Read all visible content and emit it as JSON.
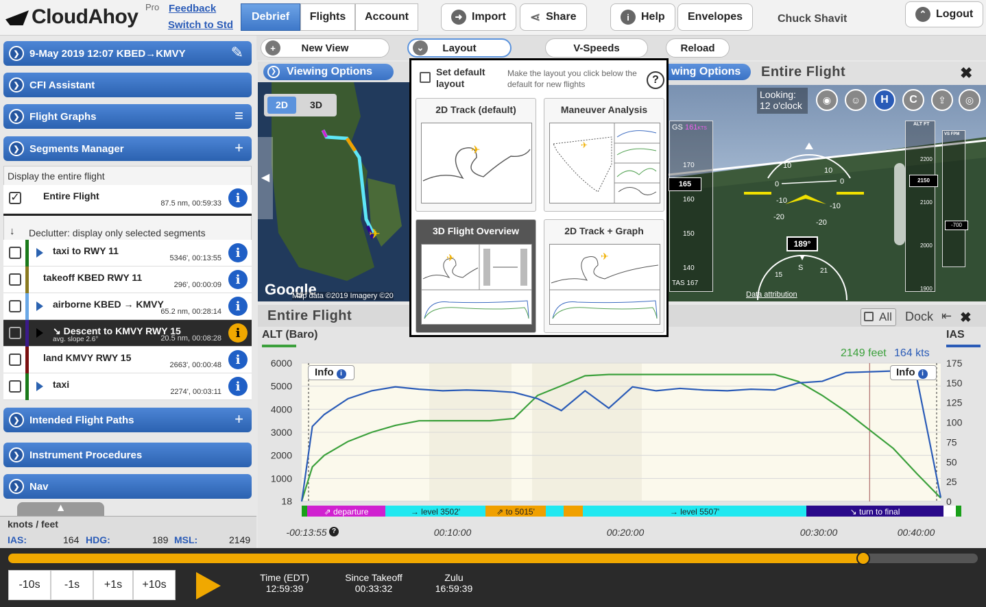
{
  "brand": {
    "logo_text": "CloudAhoy",
    "pro": "Pro",
    "feedback": "Feedback",
    "switch": "Switch to Std"
  },
  "tabs": [
    "Debrief",
    "Flights",
    "Account"
  ],
  "top_buttons": {
    "import": "Import",
    "share": "Share",
    "help": "Help",
    "envelopes": "Envelopes",
    "user": "Chuck Shavit",
    "logout": "Logout"
  },
  "sidebar": {
    "flight_header": "9-May 2019 12:07   KBED→KMVY",
    "cfi": "CFI Assistant",
    "graphs": "Flight Graphs",
    "segments": "Segments Manager",
    "display_entire": "Display the entire flight",
    "entire": {
      "name": "Entire Flight",
      "stat": "87.5 nm, 00:59:33"
    },
    "declutter": "Declutter: display only selected segments",
    "segs": [
      {
        "name": "taxi to RWY 11",
        "stat": "5346', 00:13:55",
        "color": "#1a7a1a"
      },
      {
        "name": "takeoff KBED RWY 11",
        "stat": "296', 00:00:09",
        "color": "#8a7a20"
      },
      {
        "name": "airborne KBED → KMVY",
        "stat": "65.2 nm, 00:28:14",
        "color": "#6aa8e6"
      },
      {
        "name": "↘ Descent to KMVY RWY 15",
        "sub": "avg. slope 2.6°",
        "stat": "20.5 nm, 00:08:28",
        "color": "#3a1a8a"
      },
      {
        "name": "land KMVY RWY 15",
        "stat": "2663', 00:00:48",
        "color": "#7a1010"
      },
      {
        "name": "taxi",
        "stat": "2274', 00:03:11",
        "color": "#1a7a1a"
      }
    ],
    "intended": "Intended Flight Paths",
    "instrument": "Instrument Procedures",
    "nav": "Nav",
    "units": "knots / feet",
    "ias_label": "IAS:",
    "ias": "164",
    "hdg_label": "HDG:",
    "hdg": "189",
    "msl_label": "MSL:",
    "msl": "2149"
  },
  "toolbar": {
    "new_view": "New View",
    "layout": "Layout",
    "vspeeds": "V-Speeds",
    "reload": "Reload"
  },
  "map": {
    "viewing": "Viewing Options",
    "btn2d": "2D",
    "btn3d": "3D",
    "google": "Google",
    "attrib": "Map data ©2019 Imagery ©20"
  },
  "popup": {
    "set_default": "Set default layout",
    "hint": "Make the layout you click below the default for new flights",
    "cards": [
      "2D Track (default)",
      "Maneuver Analysis",
      "3D Flight Overview",
      "2D Track + Graph"
    ]
  },
  "view3d": {
    "viewing": "wing Options",
    "title": "Entire Flight",
    "looking": "Looking:",
    "looking_val": "12 o'clock",
    "gs": "GS",
    "gs_val": "161",
    "kts": "KTS",
    "alt_ft": "ALT FT",
    "vs_fpm": "VS FPM",
    "heading": "189°",
    "alt_box": "2150",
    "spd_box": "165",
    "vs_box": "-700",
    "tas": "TAS",
    "tas_val": "167",
    "attrib": "Data attribution",
    "icon_h": "H",
    "icon_c": "C"
  },
  "graph": {
    "title": "Entire Flight",
    "all": "All",
    "dock": "Dock",
    "left_label": "ALT (Baro)",
    "right_label": "IAS",
    "readout_alt": "2149 feet",
    "readout_ias": "164 kts",
    "info": "Info",
    "left_ticks": [
      "6000",
      "5000",
      "4000",
      "3000",
      "2000",
      "1000",
      "18"
    ],
    "right_ticks": [
      "175",
      "150",
      "125",
      "100",
      "75",
      "50",
      "25",
      "0"
    ],
    "x_ticks": [
      "-00:13:55",
      "00:10:00",
      "00:20:00",
      "00:30:00",
      "00:40:00"
    ],
    "bands": [
      {
        "label": "",
        "color": "#1aa01a"
      },
      {
        "label": "⇗ departure",
        "color": "#d020d0"
      },
      {
        "label": "→ level 3502'",
        "color": "#20e8f0"
      },
      {
        "label": "⇗ to 5015'",
        "color": "#f0a000"
      },
      {
        "label": "",
        "color": "#20e8f0"
      },
      {
        "label": "",
        "color": "#f0a000"
      },
      {
        "label": "→ level 5507'",
        "color": "#20e8f0"
      },
      {
        "label": "↘ turn to final",
        "color": "#2a0a8a"
      },
      {
        "label": "",
        "color": "#ffffff"
      },
      {
        "label": "",
        "color": "#1aa01a"
      }
    ]
  },
  "chart_data": {
    "type": "line",
    "xlabel": "",
    "ylabel": "ALT (Baro)",
    "y2label": "IAS",
    "x": [
      -13.9,
      -13,
      -12,
      -10,
      -8,
      -6,
      -4,
      -2,
      0,
      2,
      4,
      6,
      8,
      10,
      12,
      14,
      16,
      18,
      20,
      22,
      24,
      26,
      28,
      30,
      32,
      34,
      36,
      38,
      40
    ],
    "series": [
      {
        "name": "ALT (Baro)",
        "axis": "left",
        "values": [
          18,
          1500,
          2000,
          2600,
          3000,
          3300,
          3500,
          3502,
          3502,
          3502,
          3600,
          4600,
          5015,
          5450,
          5507,
          5507,
          5507,
          5507,
          5507,
          5507,
          5507,
          5507,
          5200,
          4600,
          3900,
          3100,
          2300,
          1200,
          150
        ]
      },
      {
        "name": "IAS",
        "axis": "right",
        "values": [
          0,
          95,
          110,
          130,
          140,
          145,
          142,
          140,
          141,
          140,
          138,
          130,
          115,
          140,
          118,
          145,
          140,
          143,
          141,
          140,
          142,
          141,
          150,
          152,
          163,
          164,
          165,
          155,
          5
        ]
      }
    ],
    "ylim": [
      0,
      6000
    ],
    "y2lim": [
      0,
      175
    ]
  },
  "bottom": {
    "steps": [
      "-10s",
      "-1s",
      "+1s",
      "+10s"
    ],
    "time_label": "Time (EDT)",
    "time": "12:59:39",
    "since_label": "Since Takeoff",
    "since": "00:33:32",
    "zulu_label": "Zulu",
    "zulu": "16:59:39",
    "progress": 0.882
  }
}
